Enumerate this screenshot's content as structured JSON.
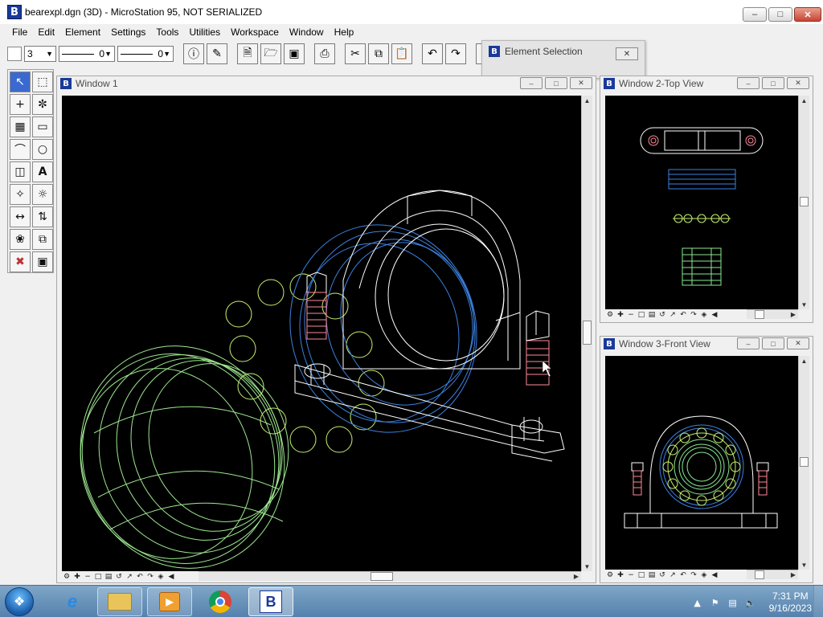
{
  "app": {
    "title": "bearexpl.dgn (3D) - MicroStation 95, NOT SERIALIZED",
    "logo_letter": "B"
  },
  "menu": [
    "File",
    "Edit",
    "Element",
    "Settings",
    "Tools",
    "Utilities",
    "Workspace",
    "Window",
    "Help"
  ],
  "toolbar": {
    "level_value": "3",
    "line_style_value": "0",
    "line_weight_value": "0",
    "icons": [
      "info-icon",
      "match-icon",
      "new-file-icon",
      "open-icon",
      "save-icon",
      "print-icon",
      "cut-icon",
      "copy-icon",
      "paste-icon",
      "undo-icon",
      "redo-icon",
      "help-icon"
    ]
  },
  "element_selection": {
    "title": "Element Selection"
  },
  "windows": {
    "main": {
      "title": "Window 1"
    },
    "top": {
      "title": "Window 2-Top View"
    },
    "front": {
      "title": "Window 3-Front View"
    }
  },
  "taskbar": {
    "time": "7:31 PM",
    "date": "9/16/2023"
  },
  "colors": {
    "view_background": "#000000",
    "housing": "#ffffff",
    "bearing": "#3a7ad8",
    "balls": "#b8f060",
    "bolts": "#ff8090",
    "race": "#8ae890"
  }
}
